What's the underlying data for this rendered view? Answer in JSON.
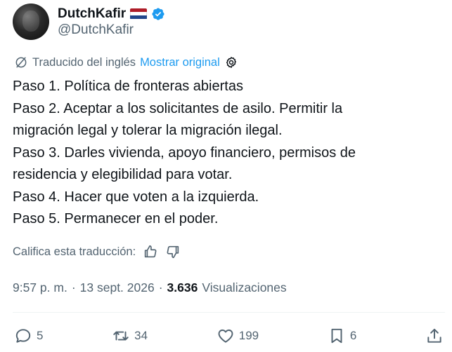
{
  "author": {
    "display_name": "DutchKafir",
    "handle": "@DutchKafir",
    "flag_colors": [
      "#ae1c28",
      "#ffffff",
      "#21468b"
    ],
    "verified_color": "#1d9bf0"
  },
  "translation": {
    "label": "Traducido del inglés",
    "show_original": "Mostrar original",
    "icon": "translate-icon",
    "settings_icon": "gear-icon"
  },
  "tweet": {
    "lines": [
      "Paso 1. Política de fronteras abiertas",
      "Paso 2. Aceptar a los solicitantes de asilo. Permitir la",
      "migración legal y tolerar la migración ilegal.",
      "Paso 3. Darles vivienda, apoyo financiero, permisos de",
      "residencia y elegibilidad para votar.",
      "Paso 4. Hacer que voten a la izquierda.",
      "Paso 5. Permanecer en el poder."
    ]
  },
  "rate": {
    "label": "Califica esta traducción:"
  },
  "meta": {
    "time": "9:57 p. m.",
    "sep1": "·",
    "date": "13 sept. 2026",
    "sep2": "·",
    "views_count": "3.636",
    "views_label": "Visualizaciones"
  },
  "actions": {
    "replies": "5",
    "reposts": "34",
    "likes": "199",
    "bookmarks": "6"
  },
  "colors": {
    "text": "#0f1419",
    "secondary": "#536471",
    "accent": "#1d9bf0",
    "divider": "#eff3f4"
  }
}
